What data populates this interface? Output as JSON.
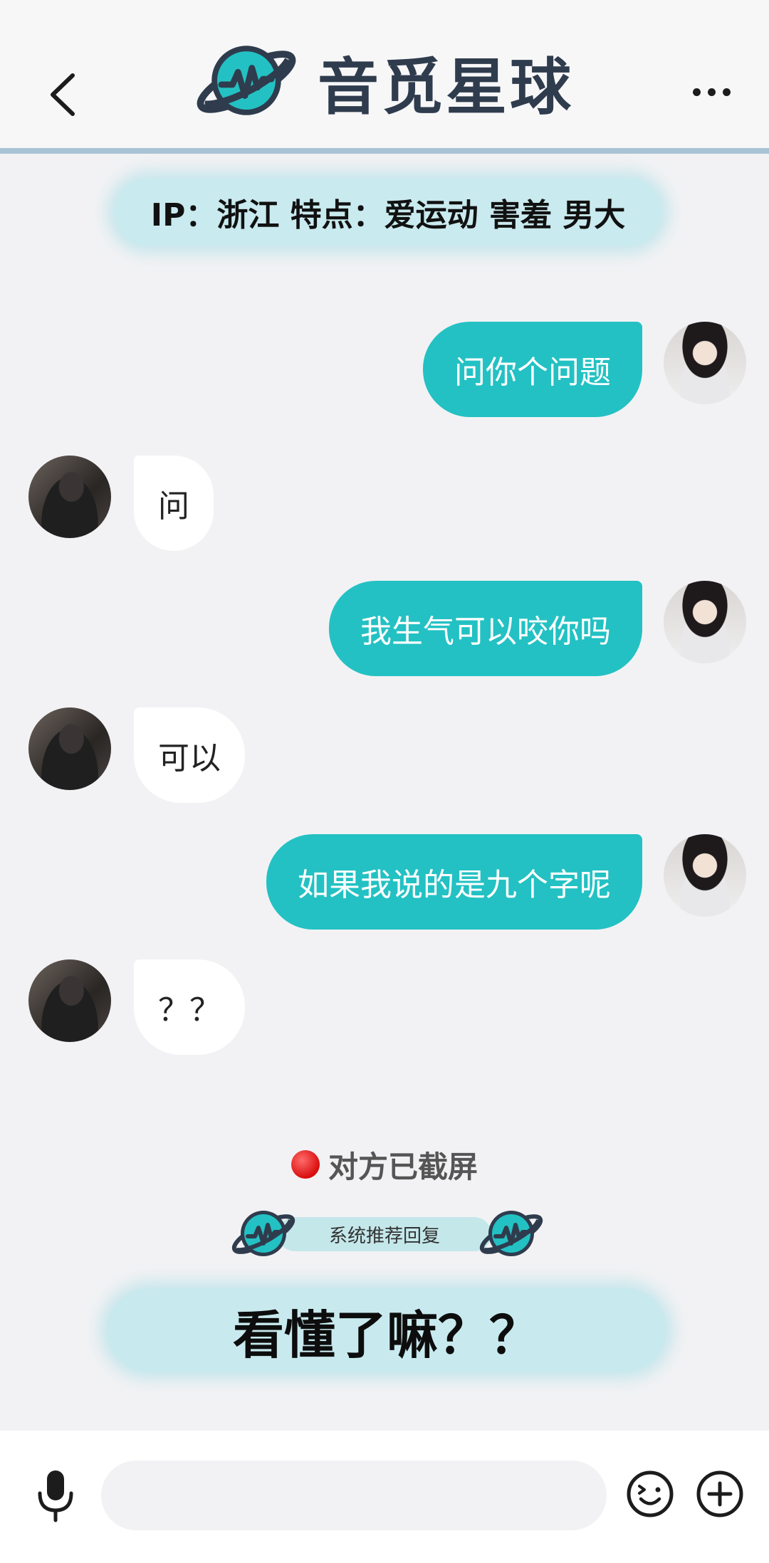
{
  "header": {
    "app_title": "音觅星球",
    "back_icon": "chevron-left-icon",
    "more_icon": "ellipsis-icon"
  },
  "profile_info": "IP：浙江  特点：爱运动 害羞 男大",
  "messages": [
    {
      "from": "self",
      "text": "问你个问题"
    },
    {
      "from": "other",
      "text": "问"
    },
    {
      "from": "self",
      "text": "我生气可以咬你吗"
    },
    {
      "from": "other",
      "text": "可以"
    },
    {
      "from": "self",
      "text": "如果我说的是九个字呢"
    },
    {
      "from": "other",
      "text": "？？"
    }
  ],
  "screenshot_notice": "对方已截屏",
  "suggestion_header": "系统推荐回复",
  "suggested_reply": "看懂了嘛？？",
  "bottom_bar": {
    "icons": [
      "mic-icon",
      "emoji-icon",
      "plus-icon"
    ]
  },
  "colors": {
    "brand": "#2f3c4d",
    "accent": "#23c1c3",
    "pill": "#c9eaee",
    "notice_dot": "#d90d0d"
  }
}
